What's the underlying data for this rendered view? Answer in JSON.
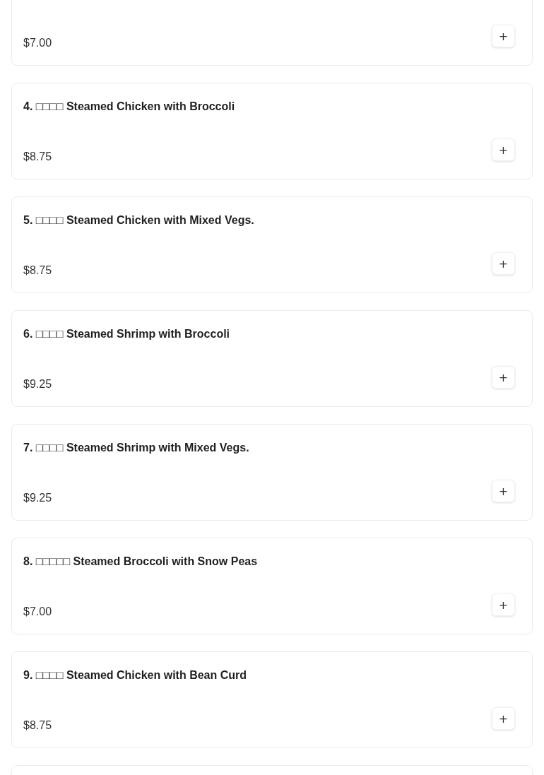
{
  "menu_items": [
    {
      "price": "$7.00",
      "add_button": "+"
    },
    {
      "name": "4. □□□□ Steamed Chicken with Broccoli",
      "price": "$8.75",
      "add_button": "+"
    },
    {
      "name": "5. □□□□ Steamed Chicken with Mixed Vegs.",
      "price": "$8.75",
      "add_button": "+"
    },
    {
      "name": "6. □□□□ Steamed Shrimp with Broccoli",
      "price": "$9.25",
      "add_button": "+"
    },
    {
      "name": "7. □□□□ Steamed Shrimp with Mixed Vegs.",
      "price": "$9.25",
      "add_button": "+"
    },
    {
      "name": "8. □□□□□ Steamed Broccoli with Snow Peas",
      "price": "$7.00",
      "add_button": "+"
    },
    {
      "name": "9. □□□□ Steamed Chicken with Bean Curd",
      "price": "$8.75",
      "add_button": "+"
    }
  ],
  "more_items_below": true
}
